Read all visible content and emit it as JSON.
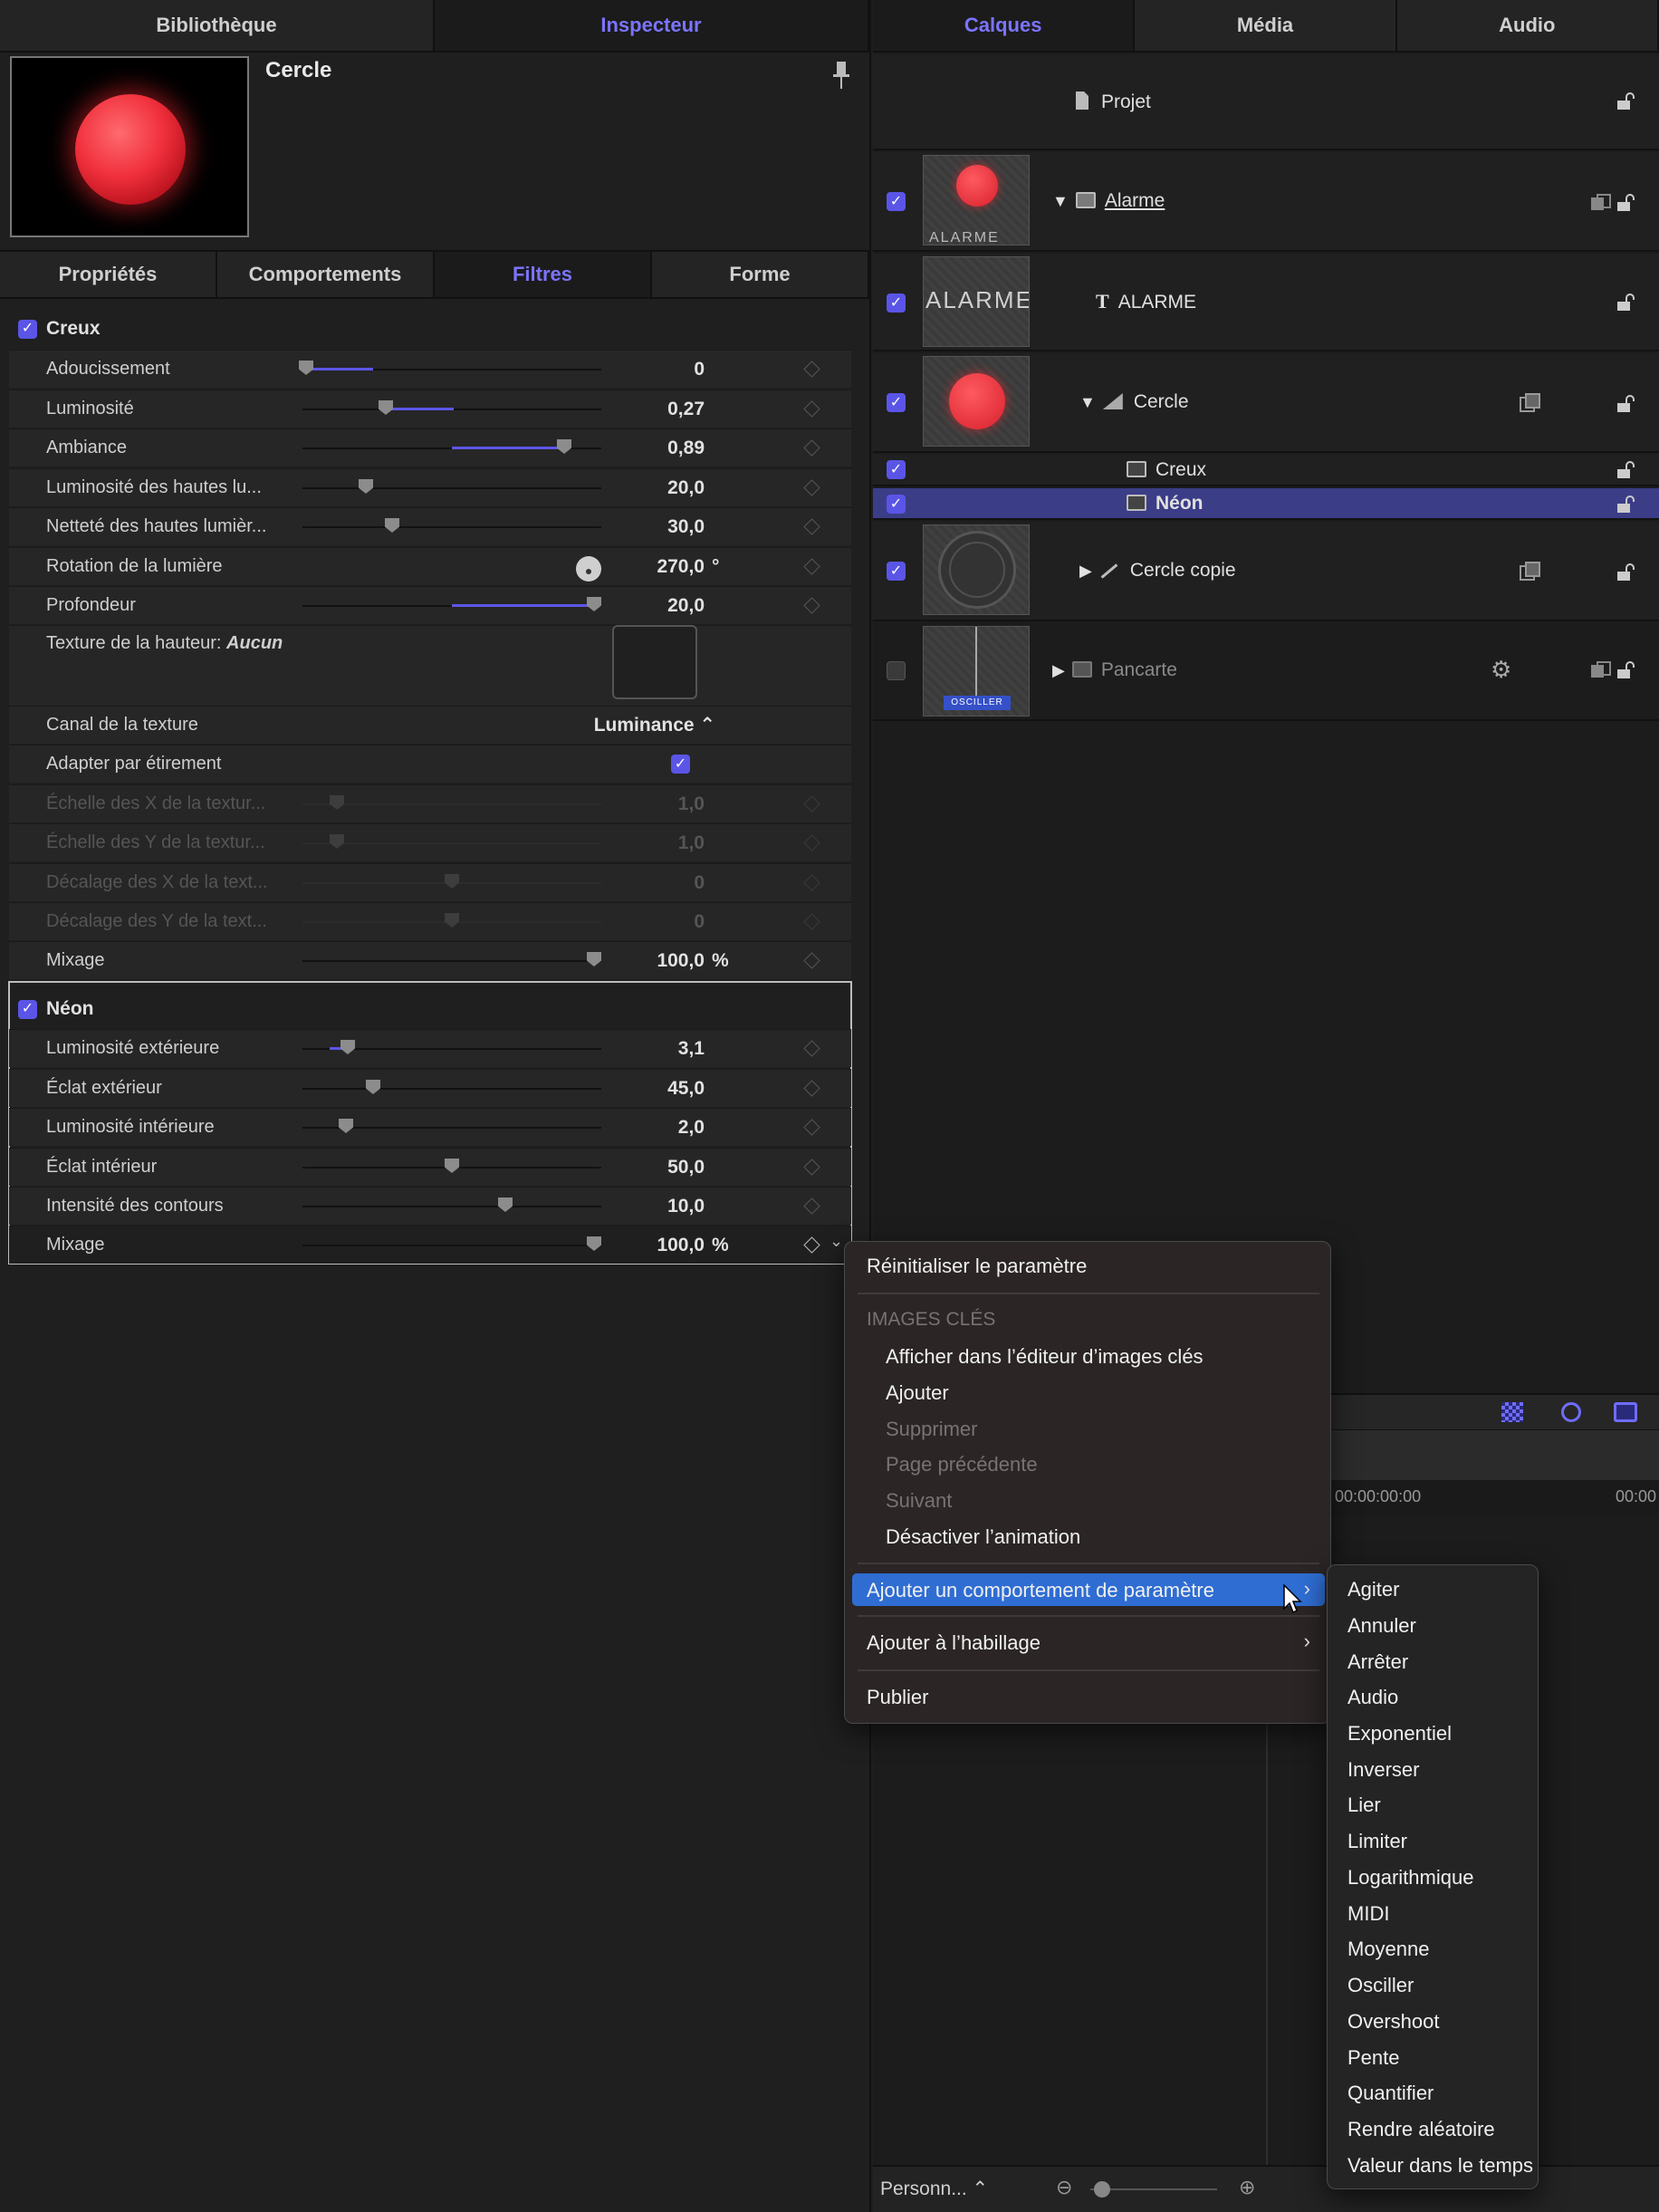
{
  "left_tabs": [
    "Bibliothèque",
    "Inspecteur"
  ],
  "right_tabs": [
    "Calques",
    "Média",
    "Audio"
  ],
  "inspector": {
    "title": "Cercle",
    "subtabs": [
      "Propriétés",
      "Comportements",
      "Filtres",
      "Forme"
    ]
  },
  "creux": {
    "label": "Creux",
    "rows": [
      {
        "label": "Adoucissement",
        "value": "0",
        "level": 0.0
      },
      {
        "label": "Luminosité",
        "value": "0,27"
      },
      {
        "label": "Ambiance",
        "value": "0,89"
      },
      {
        "label": "Luminosité des hautes lu...",
        "value": "20,0"
      },
      {
        "label": "Netteté des hautes lumièr...",
        "value": "30,0"
      },
      {
        "label": "Rotation de la lumière",
        "value": "270,0",
        "unit": "°"
      },
      {
        "label": "Profondeur",
        "value": "20,0"
      }
    ],
    "texture_label": "Texture de la hauteur:",
    "texture_value": "Aucun",
    "canal_label": "Canal de la texture",
    "canal_value": "Luminance ⌃",
    "adapter_label": "Adapter par étirement",
    "dim_rows": [
      {
        "label": "Échelle des X de la textur...",
        "value": "1,0"
      },
      {
        "label": "Échelle des Y de la textur...",
        "value": "1,0"
      },
      {
        "label": "Décalage des X de la text...",
        "value": "0"
      },
      {
        "label": "Décalage des Y de la text...",
        "value": "0"
      }
    ],
    "mix_label": "Mixage",
    "mix_value": "100,0",
    "mix_unit": "%"
  },
  "neon": {
    "label": "Néon",
    "rows": [
      {
        "label": "Luminosité extérieure",
        "value": "3,1"
      },
      {
        "label": "Éclat extérieur",
        "value": "45,0"
      },
      {
        "label": "Luminosité intérieure",
        "value": "2,0"
      },
      {
        "label": "Éclat intérieur",
        "value": "50,0"
      },
      {
        "label": "Intensité des contours",
        "value": "10,0"
      }
    ],
    "mix_label": "Mixage",
    "mix_value": "100,0",
    "mix_unit": "%"
  },
  "layers": {
    "projet": "Projet",
    "alarme": "Alarme",
    "alarme_text": "ALARME",
    "alarme_thumb_text": "ALARME",
    "cercle": "Cercle",
    "creux": "Creux",
    "neon": "Néon",
    "cercle_copie": "Cercle copie",
    "pancarte": "Pancarte",
    "pancarte_thumb_text": "OSCILLER"
  },
  "timeline": {
    "timecode1": "00:00:00:00",
    "timecode2": "00:00",
    "footer_select": "Personn... ⌃"
  },
  "context_menu": {
    "reset": "Réinitialiser le paramètre",
    "keyframes_header": "IMAGES CLÉS",
    "show_editor": "Afficher dans l’éditeur d’images clés",
    "add": "Ajouter",
    "delete": "Supprimer",
    "prev": "Page précédente",
    "next": "Suivant",
    "disable_anim": "Désactiver l’animation",
    "add_behavior": "Ajouter un comportement de paramètre",
    "add_rig": "Ajouter à l’habillage",
    "publish": "Publier"
  },
  "submenu": [
    "Agiter",
    "Annuler",
    "Arrêter",
    "Audio",
    "Exponentiel",
    "Inverser",
    "Lier",
    "Limiter",
    "Logarithmique",
    "MIDI",
    "Moyenne",
    "Osciller",
    "Overshoot",
    "Pente",
    "Quantifier",
    "Rendre aléatoire",
    "Valeur dans le temps"
  ],
  "colors": {
    "accent": "#5c56e8",
    "selection": "#3b3d87",
    "menu_highlight": "#2f6dd3"
  }
}
